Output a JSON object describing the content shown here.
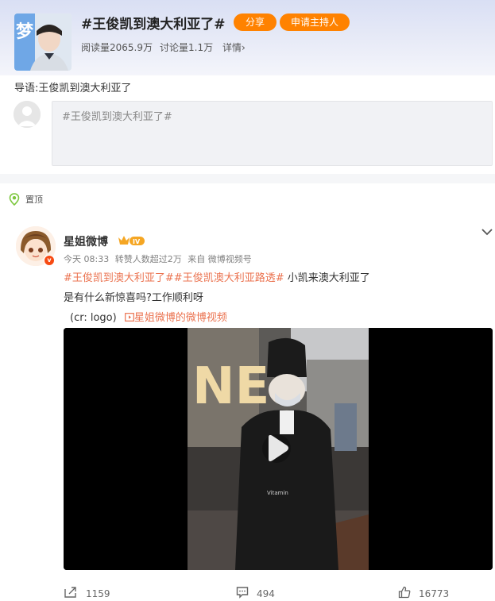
{
  "topic": {
    "title": "#王俊凯到澳大利亚了#",
    "share_label": "分享",
    "host_label": "申请主持人",
    "reads": "阅读量2065.9万",
    "discussions": "讨论量1.1万",
    "details": "详情›"
  },
  "intro": {
    "label": "导语:",
    "text": "王俊凯到澳大利亚了"
  },
  "comment_box": {
    "value": "#王俊凯到澳大利亚了#"
  },
  "pinned": {
    "label": "置顶"
  },
  "post": {
    "username": "星姐微博",
    "level_badge": "IV",
    "time": "今天 08:33",
    "likes_over": "转赞人数超过2万",
    "source": "来自 微博视频号",
    "hashtag1": "#王俊凯到澳大利亚了#",
    "hashtag2": "#王俊凯澳大利亚路透#",
    "text1": " 小凯来澳大利亚了",
    "text2": "是有什么新惊喜吗?工作顺利呀",
    "credit": "(cr: logo)",
    "video_link": "星姐微博的微博视频",
    "watermark": "Vitamin"
  },
  "actions": {
    "reposts": "1159",
    "comments": "494",
    "likes": "16773"
  },
  "colors": {
    "accent": "#ff8200",
    "link": "#eb7350",
    "badge": "#f74a12"
  },
  "icons": [
    "topic-avatar",
    "pin-icon",
    "chevron-down-icon",
    "play-icon",
    "repost-icon",
    "comment-icon",
    "like-icon",
    "video-link-icon"
  ]
}
